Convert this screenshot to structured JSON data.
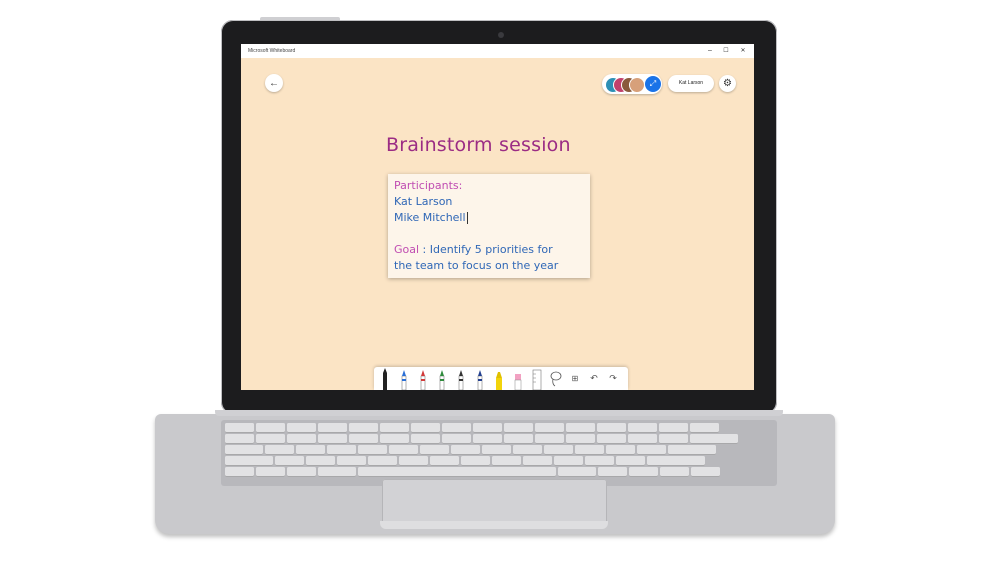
{
  "window": {
    "title": "Microsoft Whiteboard",
    "minimize": "–",
    "maximize": "☐",
    "close": "✕"
  },
  "header": {
    "back_icon": "←",
    "share_icon": "⤢",
    "user_name": "Kat Larson",
    "settings_icon": "⚙"
  },
  "board": {
    "title": "Brainstorm session",
    "note": {
      "participants_label": "Participants:",
      "participant_1": "Kat Larson",
      "participant_2": "Mike Mitchell",
      "goal_label": "Goal",
      "goal_separator": " : ",
      "goal_text_1": "Identify 5 priorities for",
      "goal_text_2": "the team to focus on the year"
    }
  },
  "colors": {
    "canvas": "#fbe4c5",
    "title": "#9b2c84",
    "note_text": "#2f67b6",
    "note_accent": "#c04db2",
    "share_button": "#1a73e8"
  },
  "toolbar": {
    "tools": [
      {
        "name": "black-pen-icon",
        "color": "#222222"
      },
      {
        "name": "blue-pen-icon",
        "color": "#2a6fd6"
      },
      {
        "name": "red-pen-icon",
        "color": "#d23a3a"
      },
      {
        "name": "green-pen-icon",
        "color": "#2f8a3c"
      },
      {
        "name": "dark-pen-icon",
        "color": "#333333"
      },
      {
        "name": "navy-pen-icon",
        "color": "#23408f"
      },
      {
        "name": "highlighter-icon",
        "color": "#f2d40b"
      },
      {
        "name": "eraser-icon",
        "color": "#f2a1c2"
      },
      {
        "name": "ruler-icon",
        "color": "#999999"
      },
      {
        "name": "lasso-icon",
        "color": "#555555"
      },
      {
        "name": "add-icon",
        "color": "#555555"
      },
      {
        "name": "undo-icon",
        "color": "#555555"
      },
      {
        "name": "redo-icon",
        "color": "#555555"
      }
    ],
    "add_glyph": "⊞",
    "undo_glyph": "↶",
    "redo_glyph": "↷"
  }
}
